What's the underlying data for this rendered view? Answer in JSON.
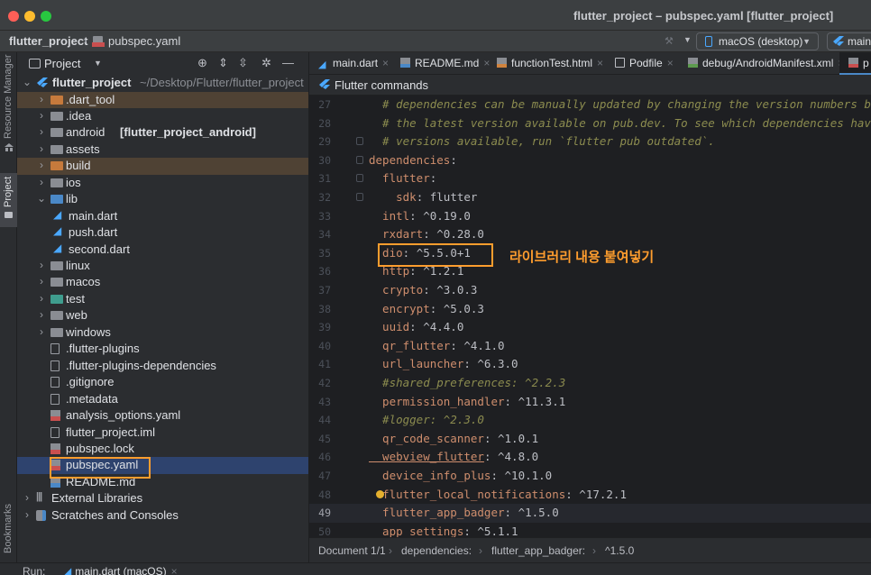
{
  "window": {
    "title": "flutter_project – pubspec.yaml [flutter_project]"
  },
  "navbar": {
    "project": "flutter_project",
    "file": "pubspec.yaml",
    "device": "macOS (desktop)",
    "run_config": "main"
  },
  "left_strip": {
    "resource_manager": "Resource Manager",
    "project": "Project",
    "bookmarks": "Bookmarks"
  },
  "project_panel": {
    "title": "Project",
    "root_name": "flutter_project",
    "root_path": "~/Desktop/Flutter/flutter_project",
    "items": [
      {
        "label": ".dart_tool",
        "type": "folder-orange"
      },
      {
        "label": ".idea",
        "type": "folder"
      },
      {
        "label": "android",
        "suffix": "[flutter_project_android]",
        "type": "folder"
      },
      {
        "label": "assets",
        "type": "folder"
      },
      {
        "label": "build",
        "type": "folder-orange"
      },
      {
        "label": "ios",
        "type": "folder"
      },
      {
        "label": "lib",
        "type": "folder-open"
      },
      {
        "label": "main.dart",
        "type": "dart"
      },
      {
        "label": "push.dart",
        "type": "dart"
      },
      {
        "label": "second.dart",
        "type": "dart"
      },
      {
        "label": "linux",
        "type": "folder"
      },
      {
        "label": "macos",
        "type": "folder"
      },
      {
        "label": "test",
        "type": "folder-green"
      },
      {
        "label": "web",
        "type": "folder"
      },
      {
        "label": "windows",
        "type": "folder"
      },
      {
        "label": ".flutter-plugins",
        "type": "file"
      },
      {
        "label": ".flutter-plugins-dependencies",
        "type": "file"
      },
      {
        "label": ".gitignore",
        "type": "file"
      },
      {
        "label": ".metadata",
        "type": "file"
      },
      {
        "label": "analysis_options.yaml",
        "type": "yaml"
      },
      {
        "label": "flutter_project.iml",
        "type": "file"
      },
      {
        "label": "pubspec.lock",
        "type": "yaml"
      },
      {
        "label": "pubspec.yaml",
        "type": "yaml"
      },
      {
        "label": "README.md",
        "type": "md"
      },
      {
        "label": "External Libraries",
        "type": "lib"
      },
      {
        "label": "Scratches and Consoles",
        "type": "scratch"
      }
    ]
  },
  "tabs": [
    {
      "label": "main.dart"
    },
    {
      "label": "README.md"
    },
    {
      "label": "functionTest.html"
    },
    {
      "label": "Podfile"
    },
    {
      "label": "debug/AndroidManifest.xml"
    },
    {
      "label": "p"
    }
  ],
  "notification": "Flutter commands",
  "code_lines": [
    {
      "n": "27",
      "text": "  # dependencies can be manually updated by changing the version numbers belo"
    },
    {
      "n": "28",
      "text": "  # the latest version available on pub.dev. To see which dependencies have n"
    },
    {
      "n": "29",
      "text": "  # versions available, run `flutter pub outdated`."
    },
    {
      "n": "30",
      "key": "dependencies",
      "val": ":"
    },
    {
      "n": "31",
      "key": "  flutter",
      "val": ":"
    },
    {
      "n": "32",
      "key": "    sdk",
      "val": ": flutter"
    },
    {
      "n": "33",
      "key": "  intl",
      "val": ": ^0.19.0"
    },
    {
      "n": "34",
      "key": "  rxdart",
      "val": ": ^0.28.0"
    },
    {
      "n": "35",
      "key": "  dio",
      "val": ": ^5.5.0+1"
    },
    {
      "n": "36",
      "key": "  http",
      "val": ": ^1.2.1"
    },
    {
      "n": "37",
      "key": "  crypto",
      "val": ": ^3.0.3"
    },
    {
      "n": "38",
      "key": "  encrypt",
      "val": ": ^5.0.3"
    },
    {
      "n": "39",
      "key": "  uuid",
      "val": ": ^4.4.0"
    },
    {
      "n": "40",
      "key": "  qr_flutter",
      "val": ": ^4.1.0"
    },
    {
      "n": "41",
      "key": "  url_launcher",
      "val": ": ^6.3.0"
    },
    {
      "n": "42",
      "comment": "  #shared_preferences: ^2.2.3"
    },
    {
      "n": "43",
      "key": "  permission_handler",
      "val": ": ^11.3.1"
    },
    {
      "n": "44",
      "comment": "  #logger: ^2.3.0"
    },
    {
      "n": "45",
      "key": "  qr_code_scanner",
      "val": ": ^1.0.1"
    },
    {
      "n": "46",
      "key": "  webview_flutter",
      "val": ": ^4.8.0"
    },
    {
      "n": "47",
      "key": "  device_info_plus",
      "val": ": ^10.1.0"
    },
    {
      "n": "48",
      "key": "  flutter_local_notifications",
      "val": ": ^17.2.1"
    },
    {
      "n": "49",
      "key": "  flutter_app_badger",
      "val": ": ^1.5.0"
    },
    {
      "n": "50",
      "key": "  app_settings",
      "val": ": ^5.1.1"
    }
  ],
  "annotation": "라이브러리 내용 붙여넣기",
  "breadcrumb": {
    "doc": "Document 1/1",
    "path1": "dependencies:",
    "path2": "flutter_app_badger:",
    "path3": "^1.5.0"
  },
  "status": {
    "run_label": "Run:",
    "run_tab": "main.dart (macOS)"
  },
  "colors": {
    "accent_orange": "#ff9d2e",
    "flutter_blue": "#4aa8ff"
  }
}
